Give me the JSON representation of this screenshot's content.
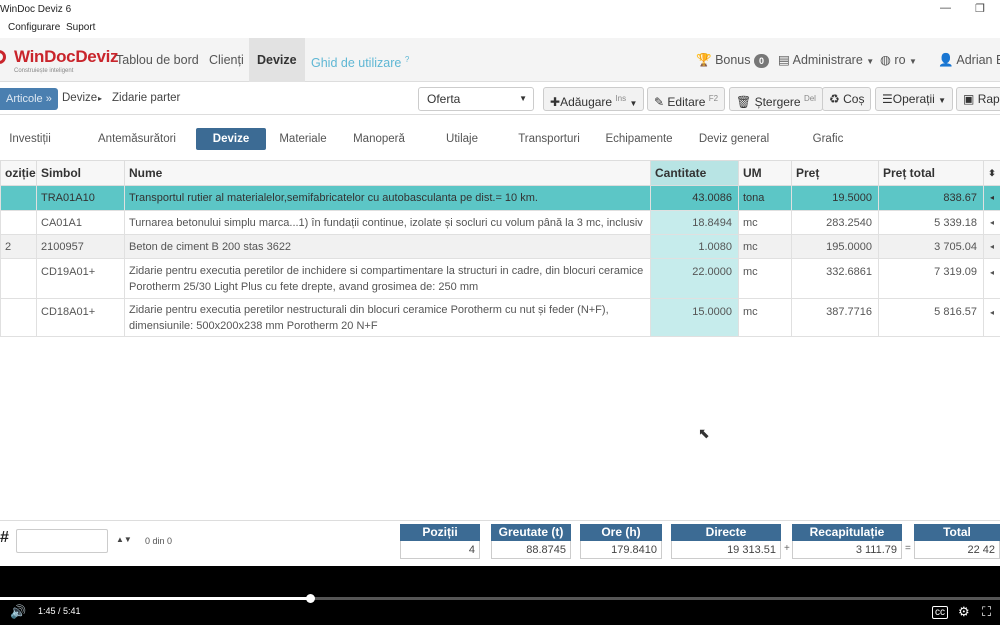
{
  "window": {
    "title": "WinDoc Deviz 6",
    "menu": [
      "Configurare",
      "Suport"
    ]
  },
  "topnav": {
    "logo": "WinDocDeviz",
    "logo_tag": "Construiește inteligent",
    "items": [
      "Tablou de bord",
      "Clienți",
      "Devize",
      "Ghid de utilizare"
    ],
    "active": "Devize",
    "bonus_label": "Bonus",
    "bonus_count": "0",
    "admin_label": "Administrare",
    "lang_label": "ro",
    "user_label": "Adrian B"
  },
  "toolbar": {
    "articles_label": "Articole »",
    "crumb_devize": "Devize",
    "crumb_current": "Zidarie parter",
    "select_value": "Oferta",
    "add_label": "Adăugare",
    "add_key": "Ins",
    "edit_label": "Editare",
    "edit_key": "F2",
    "delete_label": "Ștergere",
    "delete_key": "Del",
    "cos_label": "Coș",
    "ops_label": "Operații",
    "rap_label": "Rap"
  },
  "tabs": [
    "Investiții",
    "Antemăsurători",
    "Devize",
    "Materiale",
    "Manoperă",
    "Utilaje",
    "Transporturi",
    "Echipamente",
    "Deviz general",
    "Grafic"
  ],
  "active_tab": "Devize",
  "table": {
    "headers": {
      "pozitie": "oziție",
      "simbol": "Simbol",
      "nume": "Nume",
      "cantitate": "Cantitate",
      "um": "UM",
      "pret": "Preț",
      "pret_total": "Preț total"
    },
    "rows": [
      {
        "pozitie": "",
        "simbol": "TRA01A10",
        "nume": "Transportul rutier al materialelor,semifabricatelor cu autobasculanta pe dist.= 10 km.",
        "cantitate": "43.0086",
        "um": "tona",
        "pret": "19.5000",
        "pret_total": "838.67"
      },
      {
        "pozitie": "",
        "simbol": "CA01A1",
        "nume": "Turnarea betonului simplu marca...1) în fundații continue, izolate și socluri cu volum până la 3 mc, inclusiv",
        "cantitate": "18.8494",
        "um": "mc",
        "pret": "283.2540",
        "pret_total": "5 339.18"
      },
      {
        "pozitie": "2",
        "simbol": "2100957",
        "nume": "Beton de ciment B 200 stas 3622",
        "cantitate": "1.0080",
        "um": "mc",
        "pret": "195.0000",
        "pret_total": "3 705.04"
      },
      {
        "pozitie": "",
        "simbol": "CD19A01+",
        "nume": "Zidarie pentru executia peretilor de inchidere si compartimentare la structuri in cadre, din blocuri ceramice Porotherm 25/30 Light Plus cu fete drepte, avand grosimea de: 250 mm",
        "cantitate": "22.0000",
        "um": "mc",
        "pret": "332.6861",
        "pret_total": "7 319.09"
      },
      {
        "pozitie": "",
        "simbol": "CD18A01+",
        "nume": "Zidarie pentru executia peretilor nestructurali din blocuri ceramice Porotherm cu nut și feder (N+F), dimensiunile: 500x200x238 mm Porotherm 20 N+F",
        "cantitate": "15.0000",
        "um": "mc",
        "pret": "387.7716",
        "pret_total": "5 816.57"
      }
    ]
  },
  "summary": {
    "pager": "0 din 0",
    "pozitii": {
      "label": "Poziții",
      "value": "4"
    },
    "greutate": {
      "label": "Greutate (t)",
      "value": "88.8745"
    },
    "ore": {
      "label": "Ore (h)",
      "value": "179.8410"
    },
    "directe": {
      "label": "Directe",
      "value": "19 313.51"
    },
    "recap": {
      "label": "Recapitulație",
      "value": "3 111.79"
    },
    "total": {
      "label": "Total",
      "value": "22 42"
    }
  },
  "player": {
    "time": "1:45 / 5:41",
    "progress": 0.31
  }
}
